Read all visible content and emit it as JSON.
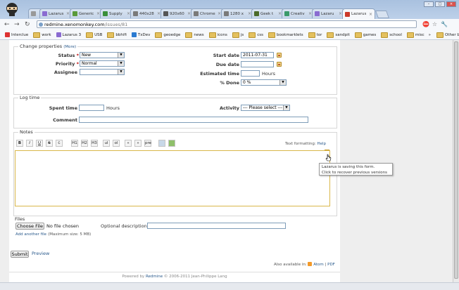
{
  "browser": {
    "tabs": [
      {
        "label": "Lazarus",
        "color": "#8a6bd1"
      },
      {
        "label": "Generic",
        "color": "#5a9a3a"
      },
      {
        "label": "Supply",
        "color": "#3a8f3a"
      },
      {
        "label": "440x28",
        "color": "#7a7a7a"
      },
      {
        "label": "920x60",
        "color": "#555555"
      },
      {
        "label": "Chrome",
        "color": "#7a7a7a"
      },
      {
        "label": "1280 x",
        "color": "#7a7a7a"
      },
      {
        "label": "Geek t",
        "color": "#4a6a2a"
      },
      {
        "label": "Creativ",
        "color": "#3a9a6a"
      },
      {
        "label": "Lazaru",
        "color": "#8a6bd1"
      },
      {
        "label": "Lazarus",
        "color": "#cc3a2a",
        "active": true
      }
    ],
    "url_domain": "redmine.xenomonkey.com",
    "url_path": "/issues/81",
    "bookmarks": [
      {
        "label": "Interclue",
        "type": "fav",
        "color": "#d33"
      },
      {
        "label": "work",
        "type": "folder"
      },
      {
        "label": "Lazarus 3",
        "type": "fav",
        "color": "#8a6bd1"
      },
      {
        "label": "USB",
        "type": "folder"
      },
      {
        "label": "bbhifi",
        "type": "folder"
      },
      {
        "label": "TxDev",
        "type": "fav",
        "color": "#2a7ad1"
      },
      {
        "label": "geoedge",
        "type": "folder"
      },
      {
        "label": "news",
        "type": "folder"
      },
      {
        "label": "icons",
        "type": "folder"
      },
      {
        "label": "js",
        "type": "folder"
      },
      {
        "label": "css",
        "type": "folder"
      },
      {
        "label": "bookmarklets",
        "type": "folder"
      },
      {
        "label": "tor",
        "type": "folder"
      },
      {
        "label": "sandpit",
        "type": "folder"
      },
      {
        "label": "games",
        "type": "folder"
      },
      {
        "label": "school",
        "type": "folder"
      },
      {
        "label": "misc",
        "type": "folder"
      }
    ],
    "bookmarks_overflow": "»",
    "other_bookmarks": "Other bookmarks"
  },
  "change_properties": {
    "legend": "Change properties",
    "more": "(More)",
    "status_label": "Status",
    "status_value": "New",
    "priority_label": "Priority",
    "priority_value": "Normal",
    "assignee_label": "Assignee",
    "assignee_value": "",
    "start_date_label": "Start date",
    "start_date_value": "2011-07-31",
    "due_date_label": "Due date",
    "due_date_value": "",
    "estimated_time_label": "Estimated time",
    "estimated_time_value": "",
    "hours": "Hours",
    "done_label": "% Done",
    "done_value": "0 %",
    "required_mark": "*"
  },
  "log_time": {
    "legend": "Log time",
    "spent_time_label": "Spent time",
    "spent_time_value": "",
    "hours": "Hours",
    "activity_label": "Activity",
    "activity_value": "--- Please select ---",
    "comment_label": "Comment",
    "comment_value": ""
  },
  "notes": {
    "legend": "Notes",
    "toolbar": [
      "B",
      "I",
      "U",
      "S",
      "C",
      "H1",
      "H2",
      "H3",
      "ul",
      "ol",
      "«",
      "»",
      "pre",
      "",
      ""
    ],
    "text_formatting": "Text formatting:",
    "help": "Help",
    "value": ""
  },
  "tooltip": {
    "line1": "Lazarus is saving this form.",
    "line2": "Click to recover previous versions"
  },
  "files": {
    "label": "Files",
    "choose_file": "Choose File",
    "no_file": "No file chosen",
    "optional_description": "Optional description",
    "add_another": "Add another file",
    "max_size": "(Maximum size: 5 MB)"
  },
  "actions": {
    "submit": "Submit",
    "preview": "Preview"
  },
  "footer": {
    "also_available": "Also available in:",
    "atom": "Atom",
    "separator": "|",
    "pdf": "PDF",
    "powered_by": "Powered by",
    "redmine": "Redmine",
    "copyright": "© 2006-2011 Jean-Philippe Lang"
  }
}
